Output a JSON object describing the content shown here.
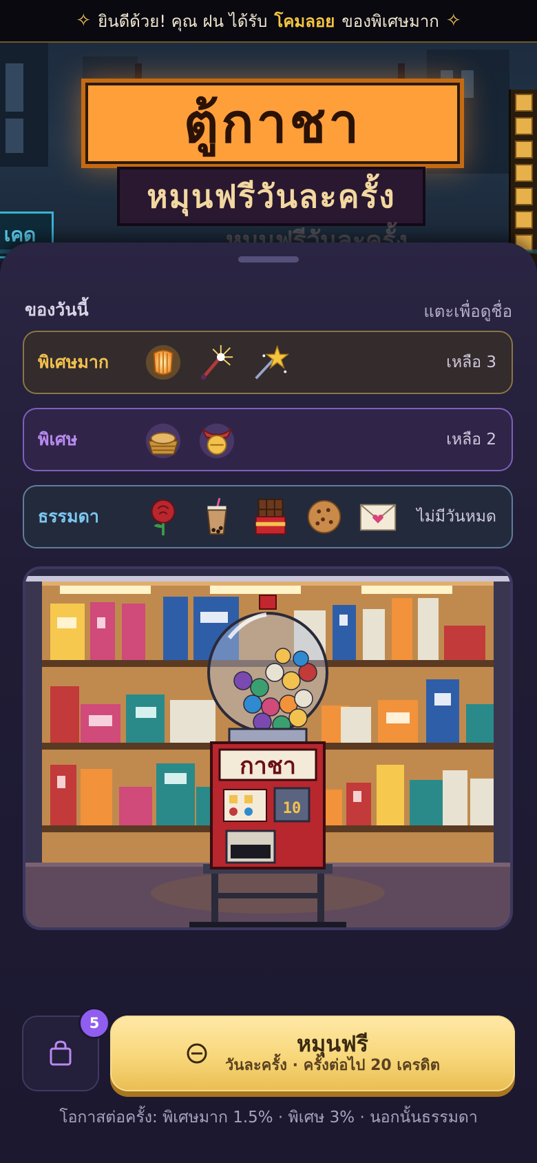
{
  "banner": {
    "prefix": "ยินดีด้วย! คุณ ฝน ได้รับ",
    "item": "โคมลอย",
    "suffix": "ของพิเศษมาก"
  },
  "hero": {
    "sign_title": "ตู้กาชา",
    "sign_subtitle": "หมุนฟรีวันละครั้ง",
    "sign_reflection": "หมุนฟรีวันละครั้ง",
    "neon_left": "เคด"
  },
  "today": {
    "title": "ของวันนี้",
    "link": "แตะเพื่อดูชื่อ",
    "tiers": [
      {
        "name": "พิเศษมาก",
        "remaining": "เหลือ 3",
        "color": "#f2c14e",
        "items": [
          "lantern-icon",
          "sparkler-icon",
          "star-wand-icon"
        ]
      },
      {
        "name": "พิเศษ",
        "remaining": "เหลือ 2",
        "color": "#b98af2",
        "items": [
          "bread-basket-icon",
          "bell-charm-icon"
        ]
      },
      {
        "name": "ธรรมดา",
        "remaining": "ไม่มีวันหมด",
        "color": "#7cc7f0",
        "items": [
          "rose-icon",
          "bubble-tea-icon",
          "chocolate-icon",
          "cookie-icon",
          "love-letter-icon"
        ]
      }
    ]
  },
  "machine": {
    "label": "กาชา",
    "coin_value": "10"
  },
  "actions": {
    "bag_count": "5",
    "spin_title": "หมุนฟรี",
    "spin_subtitle": "วันละครั้ง · ครั้งต่อไป 20 เครดิต"
  },
  "odds_text": "โอกาสต่อครั้ง: พิเศษมาก 1.5% · พิเศษ 3% · นอกนั้นธรรมดา"
}
